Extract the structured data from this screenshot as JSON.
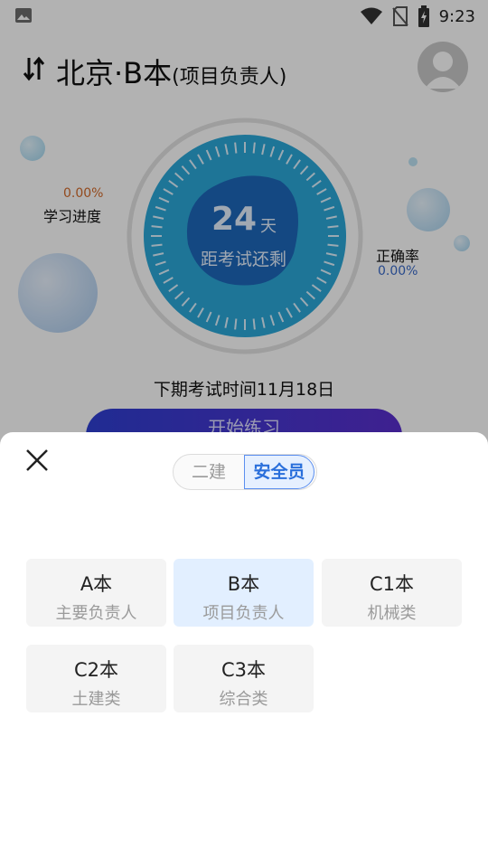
{
  "statusbar": {
    "time": "9:23"
  },
  "header": {
    "title": "北京·B本",
    "subtitle": "(项目负责人)"
  },
  "dashboard": {
    "days": "24",
    "days_unit": "天",
    "days_caption": "距考试还剩",
    "progress_value": "0.00%",
    "progress_label": "学习进度",
    "accuracy_label": "正确率",
    "accuracy_value": "0.00%",
    "next_exam": "下期考试时间11月18日",
    "start_button": "开始练习"
  },
  "sheet": {
    "segments": [
      "二建",
      "安全员"
    ],
    "active_segment": "安全员",
    "options": [
      {
        "title": "A本",
        "subtitle": "主要负责人",
        "selected": false
      },
      {
        "title": "B本",
        "subtitle": "项目负责人",
        "selected": true
      },
      {
        "title": "C1本",
        "subtitle": "机械类",
        "selected": false
      },
      {
        "title": "C2本",
        "subtitle": "土建类",
        "selected": false
      },
      {
        "title": "C3本",
        "subtitle": "综合类",
        "selected": false
      }
    ]
  },
  "colors": {
    "accent": "#2a6fdb",
    "selected_bg": "#e2efff",
    "card_bg": "#f4f4f4"
  }
}
